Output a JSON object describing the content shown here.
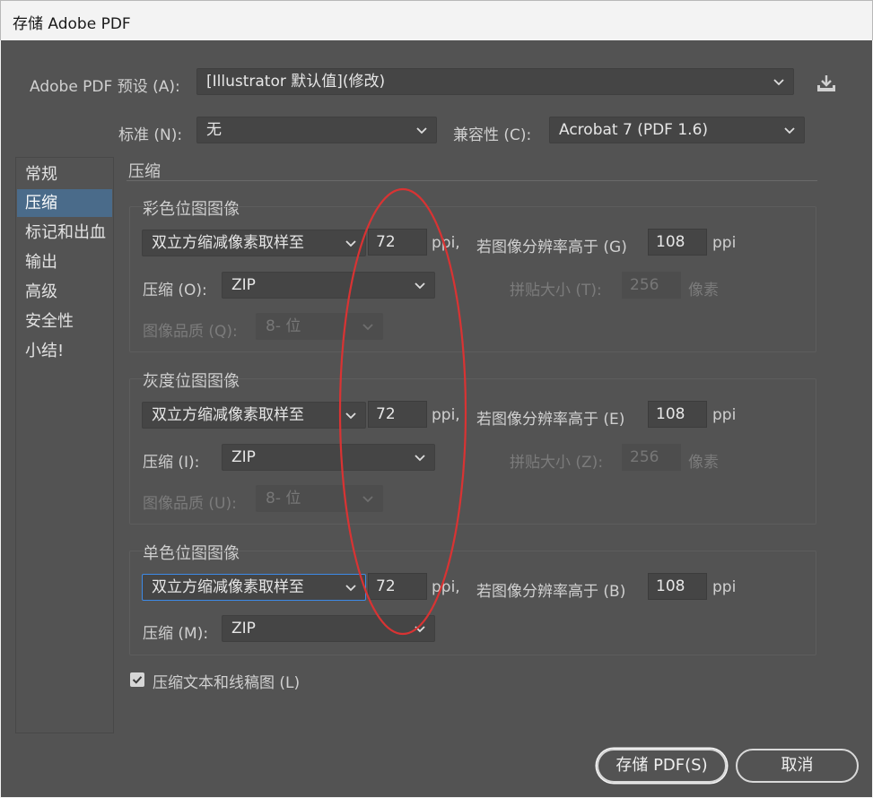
{
  "window": {
    "title": "存储 Adobe PDF"
  },
  "preset": {
    "label": "Adobe PDF 预设 (A):",
    "value": "[Illustrator 默认值](修改)"
  },
  "standard": {
    "label": "标准 (N):",
    "value": "无"
  },
  "compat": {
    "label": "兼容性 (C):",
    "value": "Acrobat 7 (PDF 1.6)"
  },
  "sidebar": {
    "items": [
      "常规",
      "压缩",
      "标记和出血",
      "输出",
      "高级",
      "安全性",
      "小结!"
    ],
    "active_index": 1
  },
  "section_title": "压缩",
  "color": {
    "title": "彩色位图图像",
    "resample": "双立方缩减像素取样至",
    "ppi": "72",
    "ppi_unit": "ppi,",
    "above_label": "若图像分辨率高于 (G)",
    "above_value": "108",
    "above_unit": "ppi",
    "compression_label": "压缩 (O):",
    "compression": "ZIP",
    "tile_label": "拼贴大小 (T):",
    "tile_value": "256",
    "tile_unit": "像素",
    "quality_label": "图像品质 (Q):",
    "quality": "8- 位"
  },
  "gray": {
    "title": "灰度位图图像",
    "resample": "双立方缩减像素取样至",
    "ppi": "72",
    "ppi_unit": "ppi,",
    "above_label": "若图像分辨率高于 (E)",
    "above_value": "108",
    "above_unit": "ppi",
    "compression_label": "压缩 (I):",
    "compression": "ZIP",
    "tile_label": "拼贴大小 (Z):",
    "tile_value": "256",
    "tile_unit": "像素",
    "quality_label": "图像品质 (U):",
    "quality": "8- 位"
  },
  "mono": {
    "title": "单色位图图像",
    "resample": "双立方缩减像素取样至",
    "ppi": "72",
    "ppi_unit": "ppi,",
    "above_label": "若图像分辨率高于 (B)",
    "above_value": "108",
    "above_unit": "ppi",
    "compression_label": "压缩 (M):",
    "compression": "ZIP"
  },
  "compress_text": {
    "label": "压缩文本和线稿图 (L)",
    "checked": true
  },
  "buttons": {
    "save": "存储 PDF(S)",
    "cancel": "取消"
  },
  "icons": {
    "save_preset": "download-icon",
    "checkbox": "check-icon",
    "dropdown": "chevron-down-icon"
  },
  "annotation": {
    "color": "#d93333"
  }
}
